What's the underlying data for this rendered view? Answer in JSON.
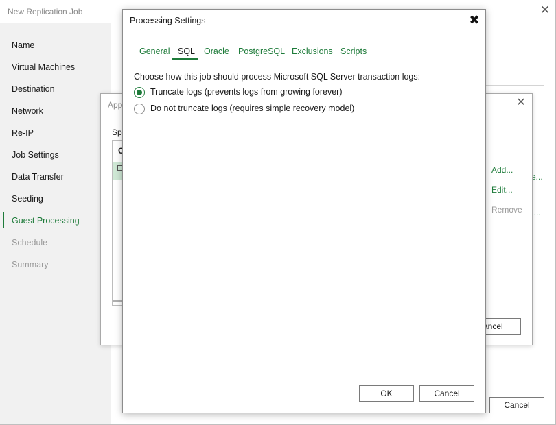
{
  "main": {
    "title": "New Replication Job",
    "close_glyph": "✕",
    "cancel_label": "Cancel",
    "side_links": [
      {
        "label": "Add...",
        "enabled": true
      },
      {
        "label": "Edit...",
        "enabled": true
      },
      {
        "label": "Remove",
        "enabled": false
      }
    ],
    "fragments": [
      "s",
      "se...",
      "d..."
    ]
  },
  "sidebar": {
    "items": [
      {
        "label": "Name",
        "state": "normal"
      },
      {
        "label": "Virtual Machines",
        "state": "normal"
      },
      {
        "label": "Destination",
        "state": "normal"
      },
      {
        "label": "Network",
        "state": "normal"
      },
      {
        "label": "Re-IP",
        "state": "normal"
      },
      {
        "label": "Job Settings",
        "state": "normal"
      },
      {
        "label": "Data Transfer",
        "state": "normal"
      },
      {
        "label": "Seeding",
        "state": "normal"
      },
      {
        "label": "Guest Processing",
        "state": "active"
      },
      {
        "label": "Schedule",
        "state": "disabled"
      },
      {
        "label": "Summary",
        "state": "disabled"
      }
    ]
  },
  "mid_dialog": {
    "title": "App",
    "close_glyph": "✕",
    "spec_text": "Spe",
    "list_header": "O",
    "cancel_label": "ancel"
  },
  "processing": {
    "title": "Processing Settings",
    "close_glyph": "✖",
    "tabs": [
      {
        "label": "General",
        "active": false
      },
      {
        "label": "SQL",
        "active": true
      },
      {
        "label": "Oracle",
        "active": false
      },
      {
        "label": "PostgreSQL",
        "active": false
      },
      {
        "label": "Exclusions",
        "active": false
      },
      {
        "label": "Scripts",
        "active": false
      }
    ],
    "prompt": "Choose how this job should process Microsoft SQL Server transaction logs:",
    "options": [
      {
        "label": "Truncate logs (prevents logs from growing forever)",
        "checked": true
      },
      {
        "label": "Do not truncate logs (requires simple recovery model)",
        "checked": false
      }
    ],
    "ok_label": "OK",
    "cancel_label": "Cancel"
  },
  "colors": {
    "accent": "#1e7b3a",
    "disabled": "#9a9a9a",
    "selection": "#cfe8d5"
  }
}
